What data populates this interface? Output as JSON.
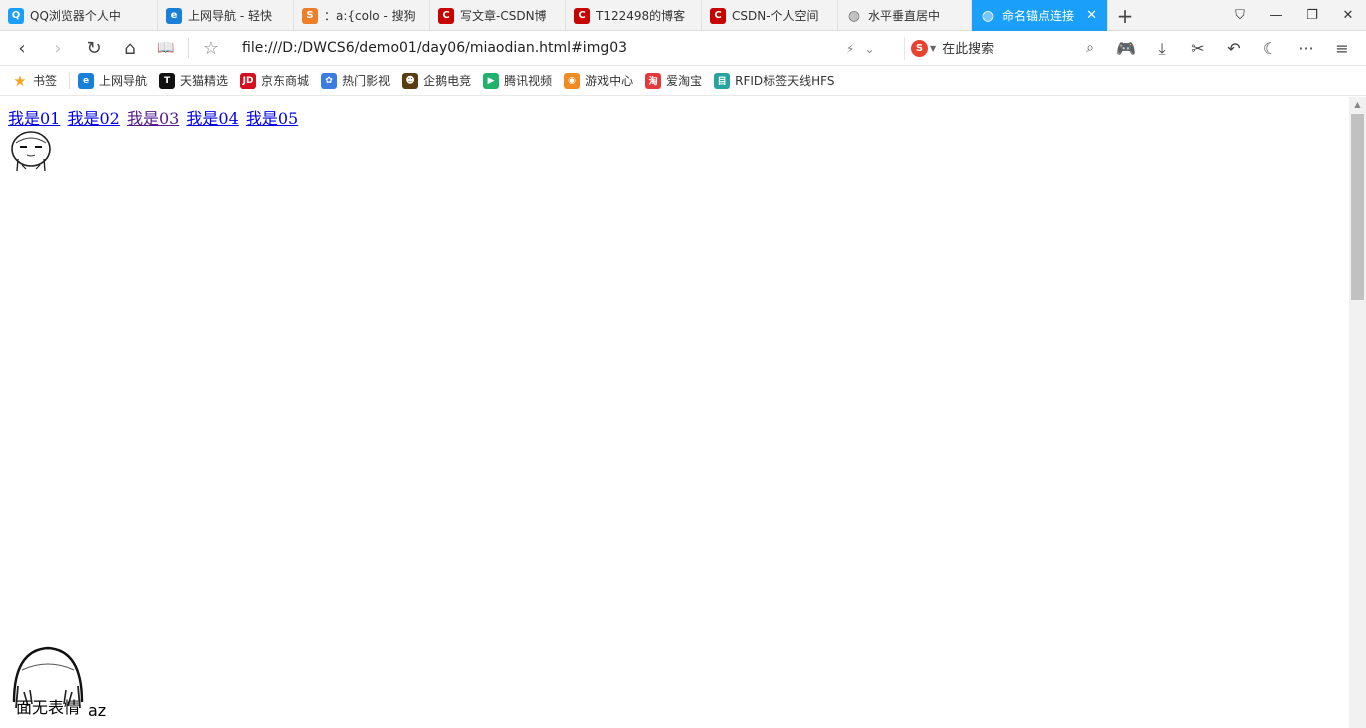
{
  "tabs": [
    {
      "label": "QQ浏览器个人中",
      "icon": "qq-browser-icon",
      "color": "#1a9ffb",
      "glyph": "Q",
      "width": 158
    },
    {
      "label": "上网导航 - 轻快",
      "icon": "ie-navigation-icon",
      "color": "#1a7fd6",
      "glyph": "e",
      "width": 136
    },
    {
      "label": "：a:{colo - 搜狗",
      "icon": "sogou-icon",
      "color": "#ef7e2a",
      "glyph": "S",
      "width": 136
    },
    {
      "label": "写文章-CSDN博",
      "icon": "csdn-icon",
      "color": "#c90000",
      "glyph": "C",
      "width": 136
    },
    {
      "label": "T122498的博客",
      "icon": "csdn-icon",
      "color": "#c90000",
      "glyph": "C",
      "width": 136
    },
    {
      "label": "CSDN-个人空间",
      "icon": "csdn-icon",
      "color": "#c90000",
      "glyph": "C",
      "width": 136
    },
    {
      "label": "水平垂直居中",
      "icon": "globe-icon",
      "color": "#777777",
      "glyph": "◍",
      "width": 134
    },
    {
      "label": "命名锚点连接",
      "icon": "globe-icon",
      "color": "#ffffff",
      "glyph": "◍",
      "width": 136,
      "active": true,
      "close": "✕"
    }
  ],
  "new_tab": "+",
  "window_controls": {
    "minimize": "—",
    "restore": "❐",
    "close": "✕",
    "skin": "⛉"
  },
  "nav": {
    "back": "‹",
    "forward": "›",
    "reload": "↻",
    "home": "⌂",
    "reader": "📖",
    "star": "☆",
    "address": "file:///D:/DWCS6/demo01/day06/miaodian.html#img03",
    "lightning": "⚡",
    "dropdown": "⌄"
  },
  "search": {
    "engine_glyph": "S",
    "placeholder": "在此搜索",
    "icon": "⌕"
  },
  "tools": {
    "game": "🎮",
    "download": "⤓",
    "cut": "✂",
    "undo": "↶",
    "night": "☾",
    "more": "···",
    "menu": "≡"
  },
  "bookmarks": [
    {
      "label": "书签",
      "icon": "star-icon",
      "color": "#f5a623",
      "glyph": "★"
    },
    {
      "label": "上网导航",
      "icon": "ie-navigation-icon",
      "color": "#1a7fd6",
      "glyph": "e"
    },
    {
      "label": "天猫精选",
      "icon": "tmall-icon",
      "color": "#111111",
      "glyph": "T"
    },
    {
      "label": "京东商城",
      "icon": "jd-icon",
      "color": "#d40f1e",
      "glyph": "JD"
    },
    {
      "label": "热门影视",
      "icon": "paw-icon",
      "color": "#3b7de0",
      "glyph": "✿"
    },
    {
      "label": "企鹅电竞",
      "icon": "penguin-esports-icon",
      "color": "#5a3b12",
      "glyph": "☻"
    },
    {
      "label": "腾讯视频",
      "icon": "tencent-video-icon",
      "color": "#20b26b",
      "glyph": "▶"
    },
    {
      "label": "游戏中心",
      "icon": "gamepad-icon",
      "color": "#f08a23",
      "glyph": "◉"
    },
    {
      "label": "爱淘宝",
      "icon": "taobao-icon",
      "color": "#e4393c",
      "glyph": "淘"
    },
    {
      "label": "RFID标签天线HFS",
      "icon": "rfid-icon",
      "color": "#27a3a0",
      "glyph": "目"
    }
  ],
  "content": {
    "links": [
      {
        "label": "我是01",
        "visited": false
      },
      {
        "label": "我是02",
        "visited": false
      },
      {
        "label": "我是03",
        "visited": true
      },
      {
        "label": "我是04",
        "visited": false
      },
      {
        "label": "我是05",
        "visited": false
      }
    ],
    "caption": "面无表情",
    "trailing_text": "az"
  }
}
